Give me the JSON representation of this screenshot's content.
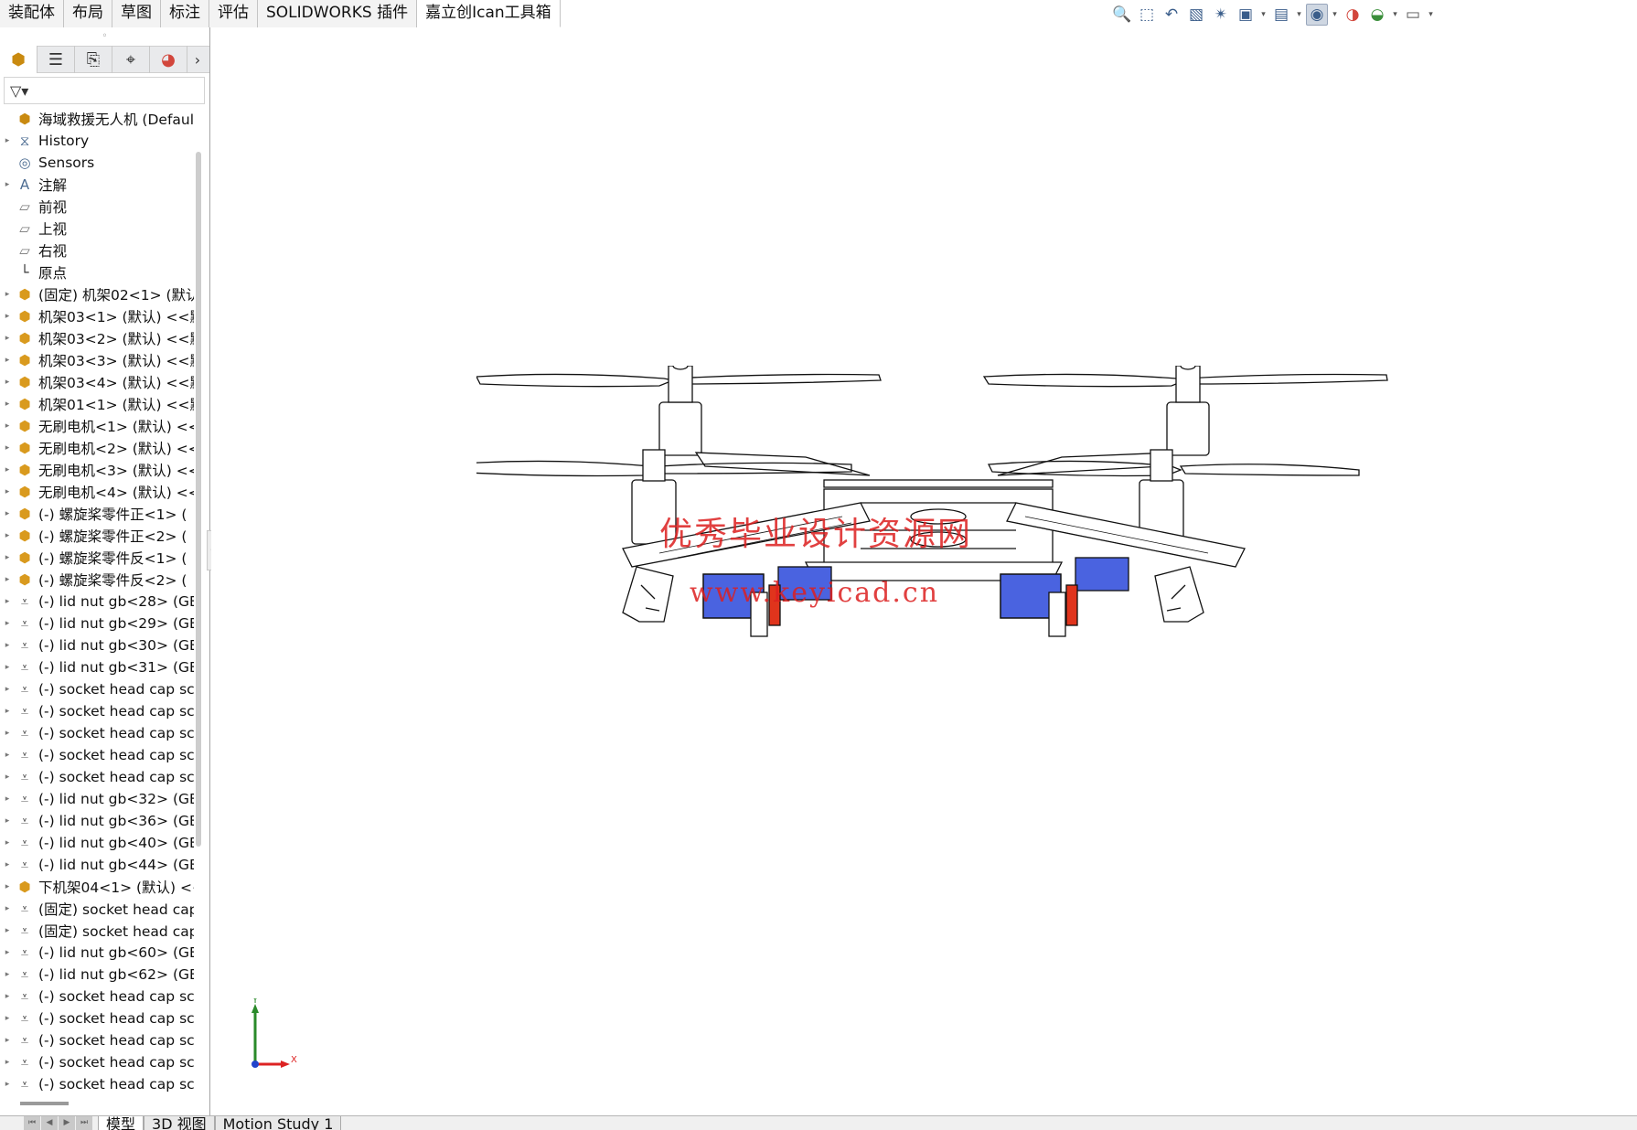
{
  "command_tabs": [
    "装配体",
    "布局",
    "草图",
    "标注",
    "评估",
    "SOLIDWORKS 插件",
    "嘉立创Ican工具箱"
  ],
  "command_tab_active_index": 6,
  "hud_icons": [
    "zoom-to-fit-icon",
    "zoom-area-icon",
    "previous-view-icon",
    "section-view-icon",
    "dynamic-annotation-icon",
    "view-orientation-icon",
    "display-style-icon",
    "hide-show-items-icon",
    "edit-appearance-icon",
    "apply-scene-icon",
    "view-settings-icon"
  ],
  "fm_tabs": [
    "featuremanager-tab-icon",
    "propertymanager-tab-icon",
    "configurationmanager-tab-icon",
    "dimxpert-tab-icon",
    "displaymanager-tab-icon"
  ],
  "tree": {
    "root": "海域救援无人机 (Default) <",
    "items": [
      {
        "label": "History",
        "icon": "history-folder",
        "expand": true
      },
      {
        "label": "Sensors",
        "icon": "sensors-folder",
        "expand": false
      },
      {
        "label": "注解",
        "icon": "annotations-folder",
        "expand": true
      },
      {
        "label": "前视",
        "icon": "plane",
        "expand": false
      },
      {
        "label": "上视",
        "icon": "plane",
        "expand": false
      },
      {
        "label": "右视",
        "icon": "plane",
        "expand": false
      },
      {
        "label": "原点",
        "icon": "origin",
        "expand": false
      },
      {
        "label": "(固定) 机架02<1> (默认",
        "icon": "part",
        "expand": true
      },
      {
        "label": "机架03<1> (默认) <<默",
        "icon": "part",
        "expand": true
      },
      {
        "label": "机架03<2> (默认) <<默",
        "icon": "part",
        "expand": true
      },
      {
        "label": "机架03<3> (默认) <<默",
        "icon": "part",
        "expand": true
      },
      {
        "label": "机架03<4> (默认) <<默",
        "icon": "part",
        "expand": true
      },
      {
        "label": "机架01<1> (默认) <<默",
        "icon": "part",
        "expand": true
      },
      {
        "label": "无刷电机<1> (默认) <<",
        "icon": "part",
        "expand": true
      },
      {
        "label": "无刷电机<2> (默认) <<",
        "icon": "part",
        "expand": true
      },
      {
        "label": "无刷电机<3> (默认) <<",
        "icon": "part",
        "expand": true
      },
      {
        "label": "无刷电机<4> (默认) <<",
        "icon": "part",
        "expand": true
      },
      {
        "label": "(-) 螺旋桨零件正<1> (",
        "icon": "part",
        "expand": true
      },
      {
        "label": "(-) 螺旋桨零件正<2> (",
        "icon": "part",
        "expand": true
      },
      {
        "label": "(-) 螺旋桨零件反<1> (",
        "icon": "part",
        "expand": true
      },
      {
        "label": "(-) 螺旋桨零件反<2> (",
        "icon": "part",
        "expand": true
      },
      {
        "label": "(-) lid nut gb<28> (GB",
        "icon": "bolt",
        "expand": true
      },
      {
        "label": "(-) lid nut gb<29> (GB",
        "icon": "bolt",
        "expand": true
      },
      {
        "label": "(-) lid nut gb<30> (GB",
        "icon": "bolt",
        "expand": true
      },
      {
        "label": "(-) lid nut gb<31> (GB",
        "icon": "bolt",
        "expand": true
      },
      {
        "label": "(-) socket head cap sc",
        "icon": "bolt",
        "expand": true
      },
      {
        "label": "(-) socket head cap sc",
        "icon": "bolt",
        "expand": true
      },
      {
        "label": "(-) socket head cap sc",
        "icon": "bolt",
        "expand": true
      },
      {
        "label": "(-) socket head cap sc",
        "icon": "bolt",
        "expand": true
      },
      {
        "label": "(-) socket head cap sc",
        "icon": "bolt",
        "expand": true
      },
      {
        "label": "(-) lid nut gb<32> (GB",
        "icon": "bolt",
        "expand": true
      },
      {
        "label": "(-) lid nut gb<36> (GB",
        "icon": "bolt",
        "expand": true
      },
      {
        "label": "(-) lid nut gb<40> (GB",
        "icon": "bolt",
        "expand": true
      },
      {
        "label": "(-) lid nut gb<44> (GB",
        "icon": "bolt",
        "expand": true
      },
      {
        "label": "下机架04<1> (默认) <<",
        "icon": "part",
        "expand": true
      },
      {
        "label": "(固定) socket head cap",
        "icon": "bolt",
        "expand": true
      },
      {
        "label": "(固定) socket head cap",
        "icon": "bolt",
        "expand": true
      },
      {
        "label": "(-) lid nut gb<60> (GB",
        "icon": "bolt",
        "expand": true
      },
      {
        "label": "(-) lid nut gb<62> (GB",
        "icon": "bolt",
        "expand": true
      },
      {
        "label": "(-) socket head cap sc",
        "icon": "bolt",
        "expand": true
      },
      {
        "label": "(-) socket head cap sc",
        "icon": "bolt",
        "expand": true
      },
      {
        "label": "(-) socket head cap sc",
        "icon": "bolt",
        "expand": true
      },
      {
        "label": "(-) socket head cap sc",
        "icon": "bolt",
        "expand": true
      },
      {
        "label": "(-) socket head cap sc",
        "icon": "bolt",
        "expand": true
      }
    ]
  },
  "watermark": {
    "line1": "优秀毕业设计资源网",
    "line2": "www.keyicad.cn"
  },
  "triad": {
    "y_label": "Y",
    "x_label": "X"
  },
  "bottom_tabs": [
    "模型",
    "3D 视图",
    "Motion Study 1"
  ],
  "bottom_tab_active_index": 0,
  "colors": {
    "motor_blue": "#4a63e0",
    "bracket_red": "#e0341c",
    "watermark_red": "#dc1e1e"
  }
}
